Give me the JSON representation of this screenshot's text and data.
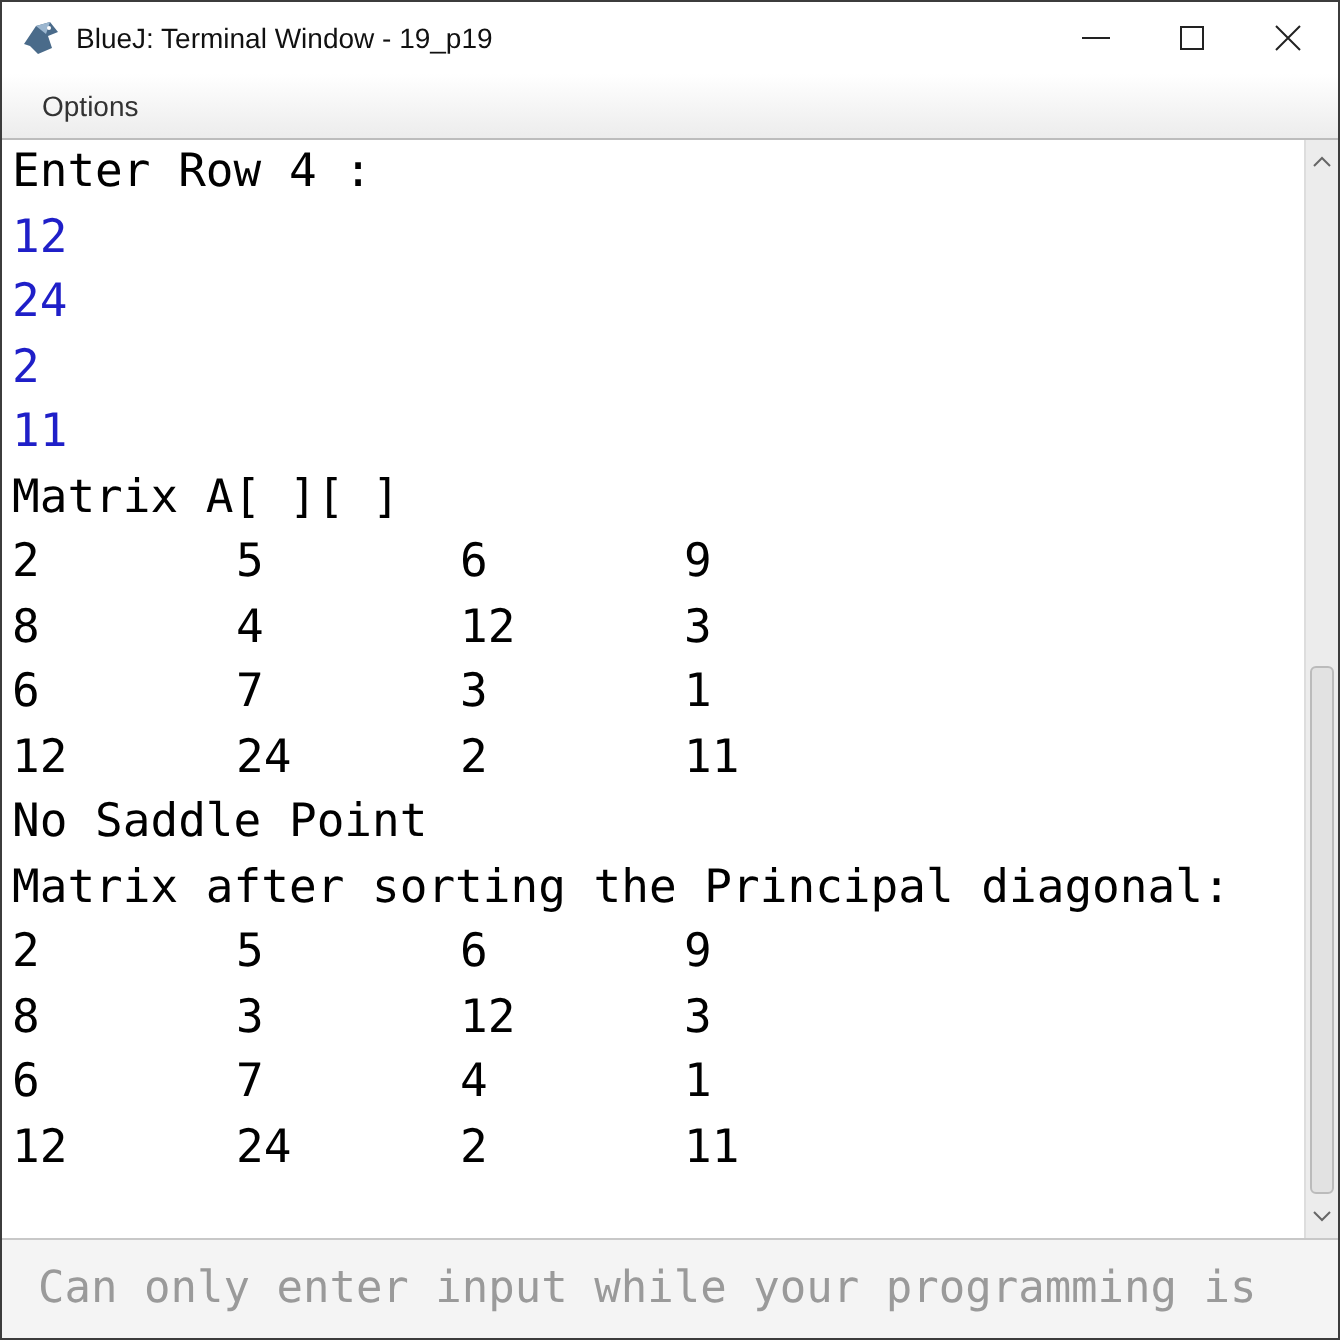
{
  "window": {
    "title": "BlueJ: Terminal Window - 19_p19"
  },
  "menu": [
    {
      "label": "Options"
    }
  ],
  "terminal": {
    "lines": [
      {
        "kind": "output",
        "text": "Enter Row 4 :"
      },
      {
        "kind": "input",
        "text": "12"
      },
      {
        "kind": "input",
        "text": "24"
      },
      {
        "kind": "input",
        "text": "2"
      },
      {
        "kind": "input",
        "text": "11"
      },
      {
        "kind": "output",
        "text": "Matrix A[ ][ ]"
      },
      {
        "kind": "row",
        "cells": [
          "2",
          "5",
          "6",
          "9"
        ]
      },
      {
        "kind": "row",
        "cells": [
          "8",
          "4",
          "12",
          "3"
        ]
      },
      {
        "kind": "row",
        "cells": [
          "6",
          "7",
          "3",
          "1"
        ]
      },
      {
        "kind": "row",
        "cells": [
          "12",
          "24",
          "2",
          "11"
        ]
      },
      {
        "kind": "output",
        "text": "No Saddle Point"
      },
      {
        "kind": "output",
        "text": "Matrix after sorting the Principal diagonal:"
      },
      {
        "kind": "row",
        "cells": [
          "2",
          "5",
          "6",
          "9"
        ]
      },
      {
        "kind": "row",
        "cells": [
          "8",
          "3",
          "12",
          "3"
        ]
      },
      {
        "kind": "row",
        "cells": [
          "6",
          "7",
          "4",
          "1"
        ]
      },
      {
        "kind": "row",
        "cells": [
          "12",
          "24",
          "2",
          "11"
        ]
      }
    ]
  },
  "input": {
    "placeholder": "Can only enter input while your programming is"
  }
}
